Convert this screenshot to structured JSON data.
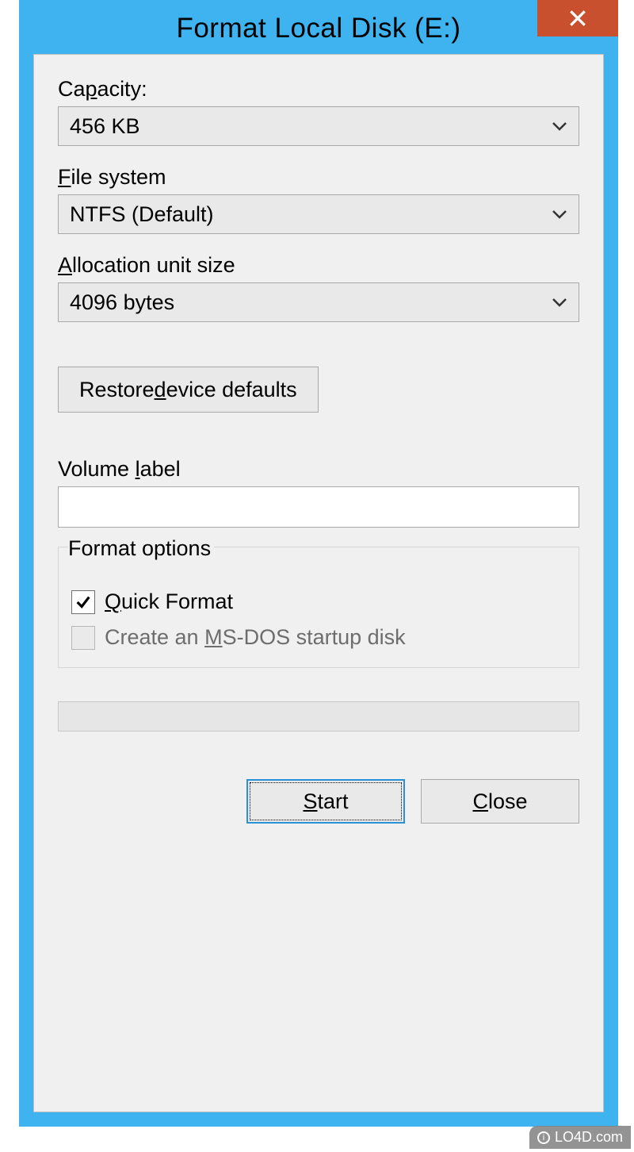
{
  "window": {
    "title": "Format Local Disk (E:)"
  },
  "capacity": {
    "label_pre": "Ca",
    "label_accel": "p",
    "label_post": "acity:",
    "value": "456 KB"
  },
  "filesystem": {
    "label_accel": "F",
    "label_post": "ile system",
    "value": "NTFS (Default)"
  },
  "allocation": {
    "label_accel": "A",
    "label_post": "llocation unit size",
    "value": "4096 bytes"
  },
  "restore": {
    "label_pre": "Restore ",
    "label_accel": "d",
    "label_post": "evice defaults"
  },
  "volume": {
    "label_pre": "Volume ",
    "label_accel": "l",
    "label_post": "abel",
    "value": ""
  },
  "format_options": {
    "legend": "Format options",
    "quick": {
      "checked": true,
      "label_accel": "Q",
      "label_post": "uick Format"
    },
    "msdos": {
      "checked": false,
      "disabled": true,
      "label_pre": "Create an ",
      "label_accel": "M",
      "label_post": "S-DOS startup disk"
    }
  },
  "buttons": {
    "start_accel": "S",
    "start_post": "tart",
    "close_accel": "C",
    "close_post": "lose"
  },
  "watermark": "LO4D.com"
}
